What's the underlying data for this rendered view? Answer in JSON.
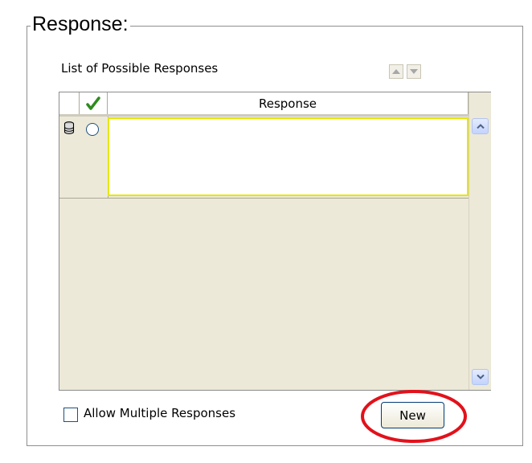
{
  "group": {
    "title": "Response:"
  },
  "list": {
    "label": "List of Possible Responses",
    "nav": [
      {
        "name": "move-up",
        "icon": "triangle-up-icon"
      },
      {
        "name": "move-down",
        "icon": "triangle-down-icon"
      }
    ]
  },
  "grid": {
    "columns": [
      {
        "label": "",
        "icon": "blank"
      },
      {
        "label": "",
        "icon": "checkmark-icon",
        "color": "#2e8b1e"
      },
      {
        "label": "Response"
      }
    ],
    "rows": [
      {
        "indicator_icon": "database-icon",
        "selected": false,
        "response": ""
      }
    ]
  },
  "scrollbar": {
    "up_icon": "chevron-up-icon",
    "down_icon": "chevron-down-icon"
  },
  "options": {
    "allow_multiple_label": "Allow Multiple Responses",
    "allow_multiple_checked": false
  },
  "buttons": {
    "new_label": "New"
  },
  "annotation": {
    "shape": "ellipse",
    "color": "#e2111b",
    "target": "new-button"
  }
}
